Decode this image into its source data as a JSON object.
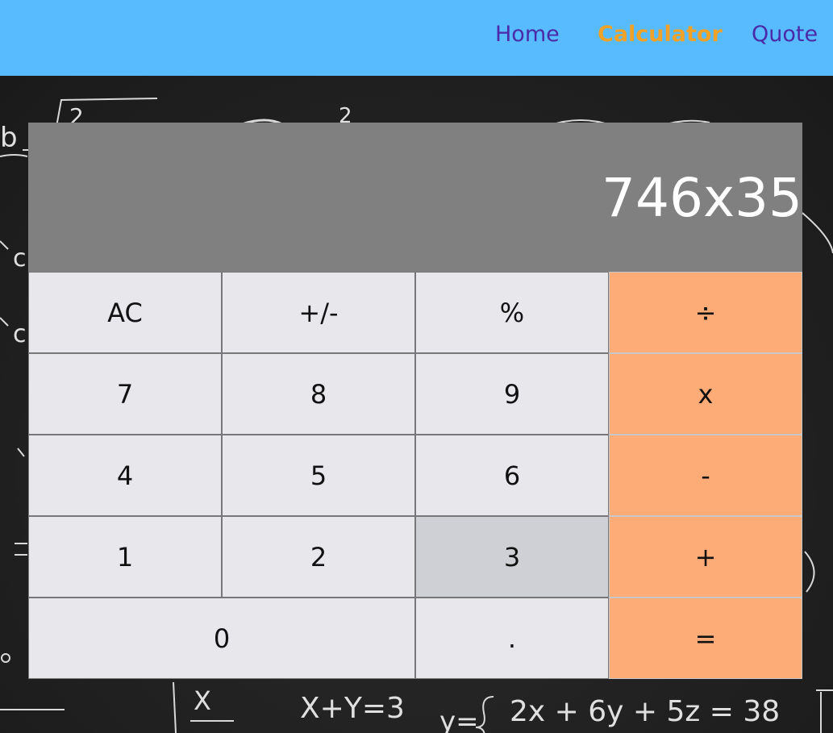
{
  "nav": {
    "home": "Home",
    "calculator": "Calculator",
    "quote": "Quote",
    "active": "Calculator"
  },
  "background": {
    "equations": [
      "2",
      "X",
      "X+Y=3",
      "y=",
      "2x + 6y + 5z = 38",
      "b",
      "c",
      "c"
    ]
  },
  "calculator": {
    "display": "746x35",
    "keys": {
      "ac": "AC",
      "sign": "+/-",
      "percent": "%",
      "divide": "÷",
      "seven": "7",
      "eight": "8",
      "nine": "9",
      "multiply": "x",
      "four": "4",
      "five": "5",
      "six": "6",
      "minus": "-",
      "one": "1",
      "two": "2",
      "three": "3",
      "plus": "+",
      "zero": "0",
      "decimal": ".",
      "equals": "="
    },
    "pressed_key": "3"
  },
  "colors": {
    "navbar": "#58bbfe",
    "nav_link": "#4a2aa8",
    "nav_active": "#f0a128",
    "display_bg": "#808080",
    "key_bg": "#e8e7ec",
    "key_pressed": "#cfd0d5",
    "operator_bg": "#fdac77"
  }
}
